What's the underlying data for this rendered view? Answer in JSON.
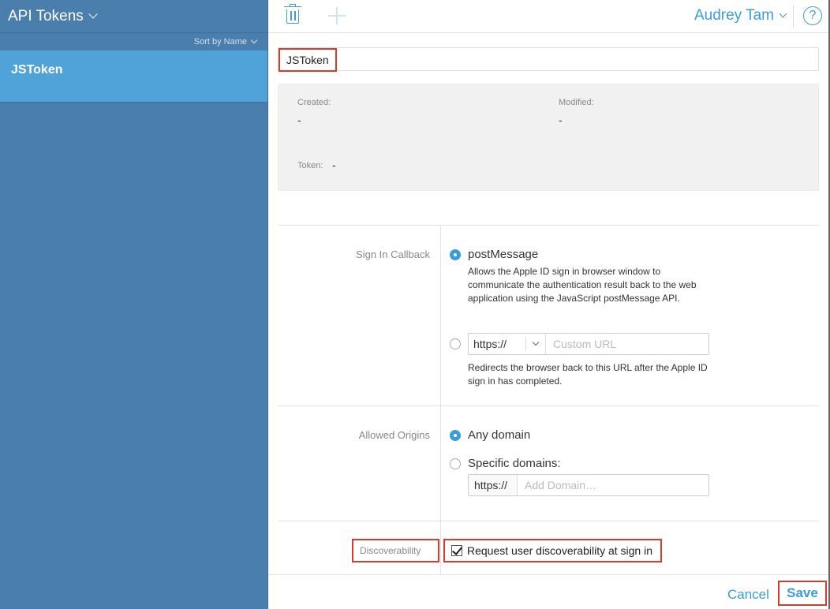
{
  "sidebar": {
    "title": "API Tokens",
    "sort_label": "Sort by Name",
    "items": [
      {
        "label": "JSToken"
      }
    ]
  },
  "topbar": {
    "user_name": "Audrey Tam",
    "help_glyph": "?"
  },
  "token": {
    "name": "JSToken",
    "created_label": "Created:",
    "created_value": "-",
    "modified_label": "Modified:",
    "modified_value": "-",
    "token_label": "Token:",
    "token_value": "-"
  },
  "sign_in_callback": {
    "label": "Sign In Callback",
    "option1_label": "postMessage",
    "option1_desc": "Allows the Apple ID sign in browser window to communicate the authentication result back to the web application using the JavaScript postMessage API.",
    "scheme": "https://",
    "url_placeholder": "Custom URL",
    "option2_desc": "Redirects the browser back to this URL after the Apple ID sign in has completed."
  },
  "allowed_origins": {
    "label": "Allowed Origins",
    "option1_label": "Any domain",
    "option2_label": "Specific domains:",
    "scheme": "https://",
    "domain_placeholder": "Add Domain…"
  },
  "discoverability": {
    "label": "Discoverability",
    "checkbox_label": "Request user discoverability at sign in",
    "checked": true
  },
  "footer": {
    "cancel_label": "Cancel",
    "save_label": "Save"
  },
  "colors": {
    "accent": "#3b9cdb",
    "sidebar": "#4a7fad",
    "sidebar_selected": "#4fa3d8",
    "highlight": "#d93a2f"
  }
}
